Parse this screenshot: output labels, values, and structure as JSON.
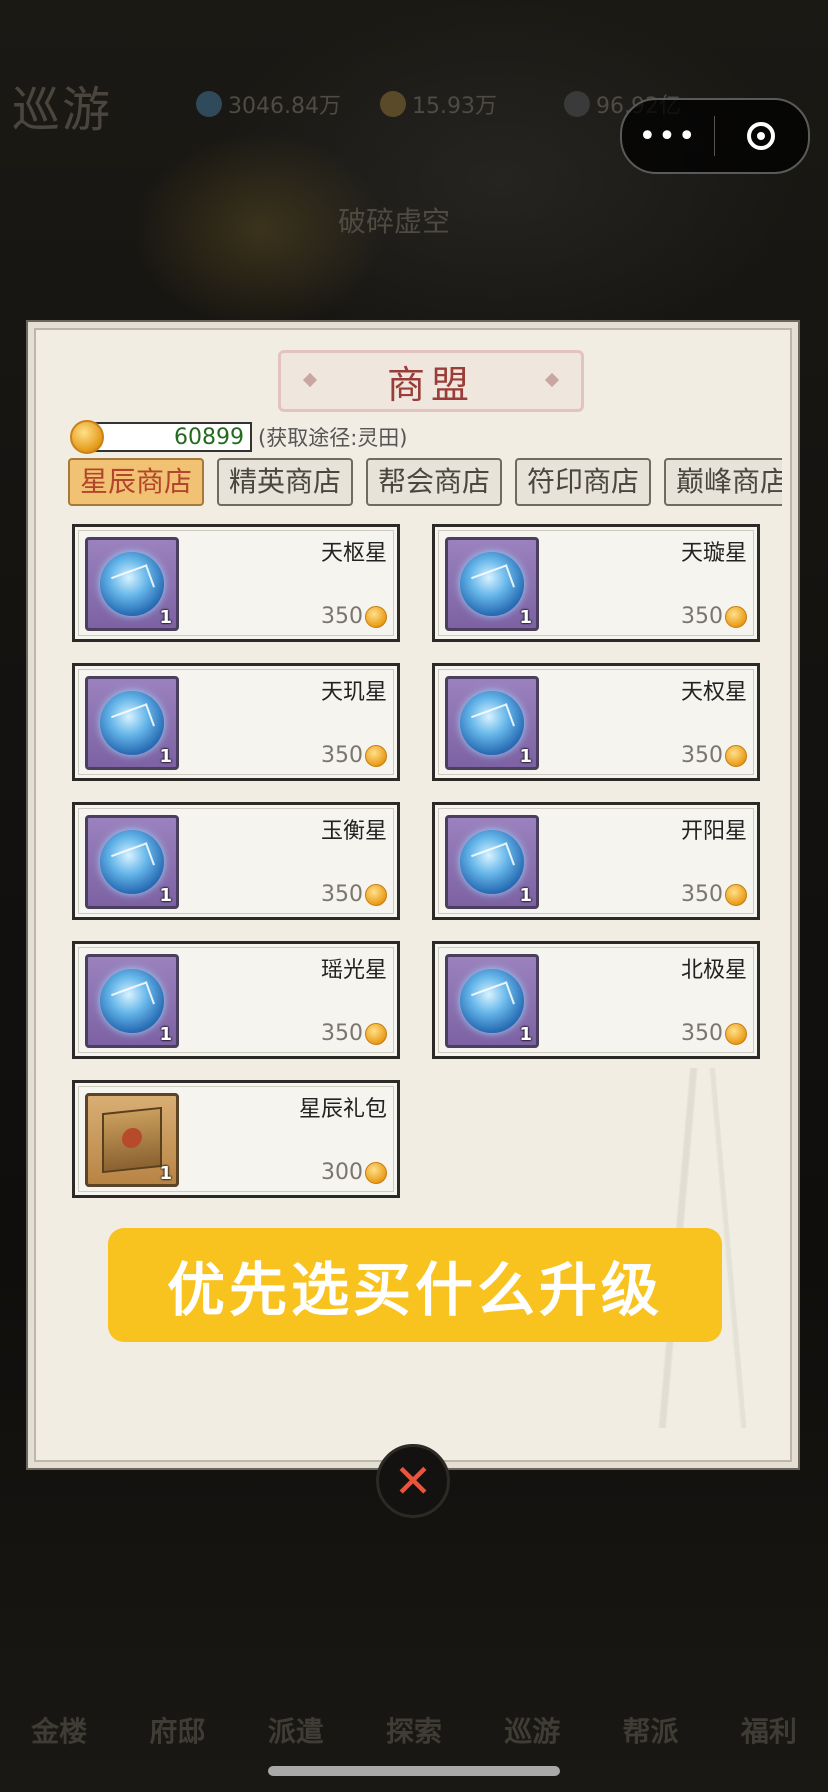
{
  "game": {
    "screen_title": "巡游",
    "stats": [
      {
        "icon": "spirit-stone-icon",
        "value": "3046.84万"
      },
      {
        "icon": "gourd-icon",
        "value": "15.93万"
      },
      {
        "icon": "power-icon",
        "value": "96.92亿"
      }
    ],
    "subtitle": "破碎虚空"
  },
  "capsule": {
    "more_label": "•••"
  },
  "shop": {
    "title": "商盟",
    "currency": {
      "icon": "coin-icon",
      "amount": "60899",
      "hint": "(获取途径:灵田)"
    },
    "tabs": [
      {
        "label": "星辰商店",
        "active": true
      },
      {
        "label": "精英商店",
        "active": false
      },
      {
        "label": "帮会商店",
        "active": false
      },
      {
        "label": "符印商店",
        "active": false
      },
      {
        "label": "巅峰商店",
        "active": false
      }
    ],
    "items": [
      {
        "name": "天枢星",
        "qty": "1",
        "price": "350",
        "icon": "star-orb-icon"
      },
      {
        "name": "天璇星",
        "qty": "1",
        "price": "350",
        "icon": "star-orb-icon"
      },
      {
        "name": "天玑星",
        "qty": "1",
        "price": "350",
        "icon": "star-orb-icon"
      },
      {
        "name": "天权星",
        "qty": "1",
        "price": "350",
        "icon": "star-orb-icon"
      },
      {
        "name": "玉衡星",
        "qty": "1",
        "price": "350",
        "icon": "star-orb-icon"
      },
      {
        "name": "开阳星",
        "qty": "1",
        "price": "350",
        "icon": "star-orb-icon"
      },
      {
        "name": "瑶光星",
        "qty": "1",
        "price": "350",
        "icon": "star-orb-icon"
      },
      {
        "name": "北极星",
        "qty": "1",
        "price": "350",
        "icon": "star-orb-icon"
      },
      {
        "name": "星辰礼包",
        "qty": "1",
        "price": "300",
        "icon": "gift-box-icon"
      }
    ]
  },
  "overlay_banner": "优先选买什么升级",
  "bottom_nav": [
    "金楼",
    "府邸",
    "派遣",
    "探索",
    "巡游",
    "帮派",
    "福利"
  ],
  "colors": {
    "banner": "#f8c21f",
    "active_tab": "#f2c274",
    "title_red": "#9a3c37",
    "amount_green": "#236a1f"
  }
}
